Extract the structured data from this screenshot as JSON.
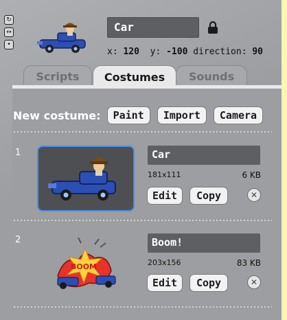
{
  "sprite": {
    "name": "Car",
    "x_label": "x:",
    "x_value": "120",
    "y_label": "y:",
    "y_value": "-100",
    "direction_label": "direction:",
    "direction_value": "90"
  },
  "tabs": [
    {
      "label": "Scripts",
      "active": false
    },
    {
      "label": "Costumes",
      "active": true
    },
    {
      "label": "Sounds",
      "active": false
    }
  ],
  "new_costume": {
    "label": "New costume:",
    "paint": "Paint",
    "import": "Import",
    "camera": "Camera"
  },
  "costumes": [
    {
      "index": "1",
      "name": "Car",
      "dimensions": "181x111",
      "size": "6 KB",
      "edit": "Edit",
      "copy": "Copy"
    },
    {
      "index": "2",
      "name": "Boom!",
      "dimensions": "203x156",
      "size": "83 KB",
      "edit": "Edit",
      "copy": "Copy"
    }
  ],
  "boom_text": "BOOM",
  "colors": {
    "selection": "#4d8ee0",
    "panel": "#9c9ea1",
    "field": "#5d5f62"
  }
}
